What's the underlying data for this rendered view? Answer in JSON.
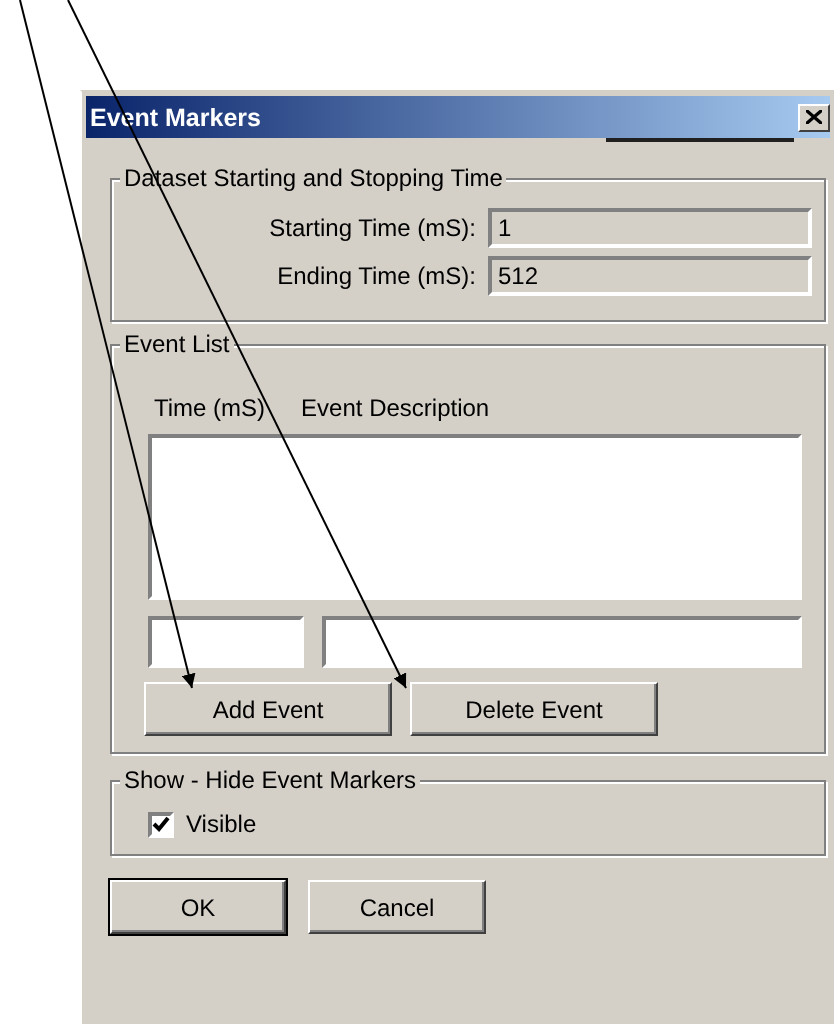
{
  "window": {
    "title": "Event Markers"
  },
  "dataset_group": {
    "title": "Dataset Starting and Stopping Time",
    "fields": [
      {
        "label": "Starting Time (mS):",
        "value": "1"
      },
      {
        "label": "Ending Time (mS):",
        "value": "512"
      }
    ]
  },
  "event_list": {
    "title": "Event List",
    "columns": [
      "Time (mS)",
      "Event Description"
    ],
    "buttons": [
      "Add Event",
      "Delete Event"
    ]
  },
  "markers_group": {
    "title": "Show - Hide Event Markers",
    "checkbox": {
      "label": "Visible",
      "checked": true
    }
  },
  "buttons": [
    {
      "label": "OK",
      "default": true
    },
    {
      "label": "Cancel",
      "default": false
    }
  ]
}
